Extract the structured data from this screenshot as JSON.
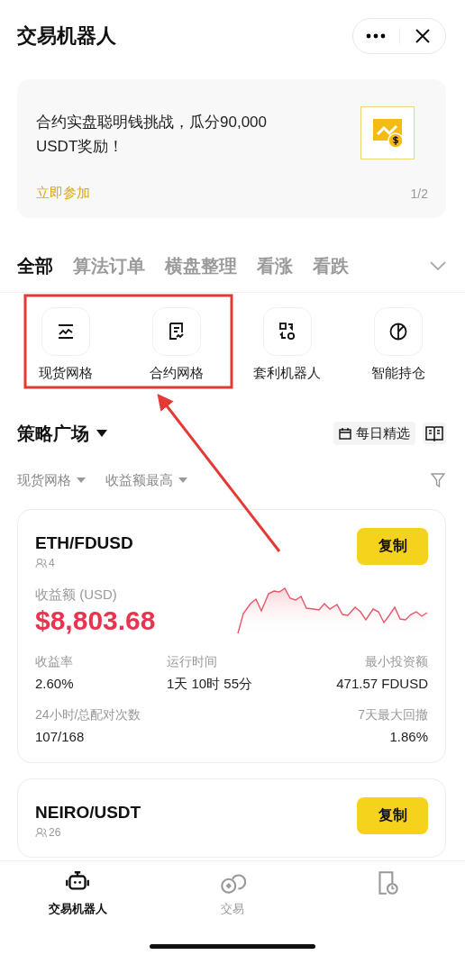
{
  "header": {
    "title": "交易机器人"
  },
  "banner": {
    "text": "合约实盘聪明钱挑战，瓜分90,000 USDT奖励！",
    "link": "立即参加",
    "pager": "1/2"
  },
  "category_tabs": [
    {
      "label": "全部",
      "selected": true
    },
    {
      "label": "算法订单",
      "selected": false
    },
    {
      "label": "横盘整理",
      "selected": false
    },
    {
      "label": "看涨",
      "selected": false
    },
    {
      "label": "看跌",
      "selected": false
    }
  ],
  "shortcuts": [
    {
      "label": "现货网格",
      "kind": "spot-grid"
    },
    {
      "label": "合约网格",
      "kind": "futures-grid"
    },
    {
      "label": "套利机器人",
      "kind": "arbitrage"
    },
    {
      "label": "智能持仓",
      "kind": "portfolio"
    }
  ],
  "section": {
    "title": "策略广场",
    "daily_pick": "每日精选"
  },
  "filters": [
    {
      "label": "现货网格"
    },
    {
      "label": "收益额最高"
    }
  ],
  "strategies": [
    {
      "pair": "ETH/FDUSD",
      "followers": "4",
      "button": "复制",
      "profit_label": "收益额 (USD)",
      "profit": "$8,803.68",
      "stat_rows": [
        [
          {
            "label": "收益率",
            "value": "2.60%"
          },
          {
            "label": "运行时间",
            "value": "1天 10时 55分"
          },
          {
            "label": "最小投资额",
            "value": "471.57 FDUSD"
          }
        ],
        [
          {
            "label": "24小时/总配对次数",
            "value": "107/168"
          },
          {
            "label": "7天最大回撤",
            "value": "1.86%"
          }
        ]
      ]
    },
    {
      "pair": "NEIRO/USDT",
      "followers": "26",
      "button": "复制"
    }
  ],
  "bottom_nav": [
    {
      "label": "交易机器人",
      "kind": "robot",
      "selected": true
    },
    {
      "label": "交易",
      "kind": "exchange",
      "selected": false
    },
    {
      "kind": "document-clock",
      "selected": false
    }
  ]
}
